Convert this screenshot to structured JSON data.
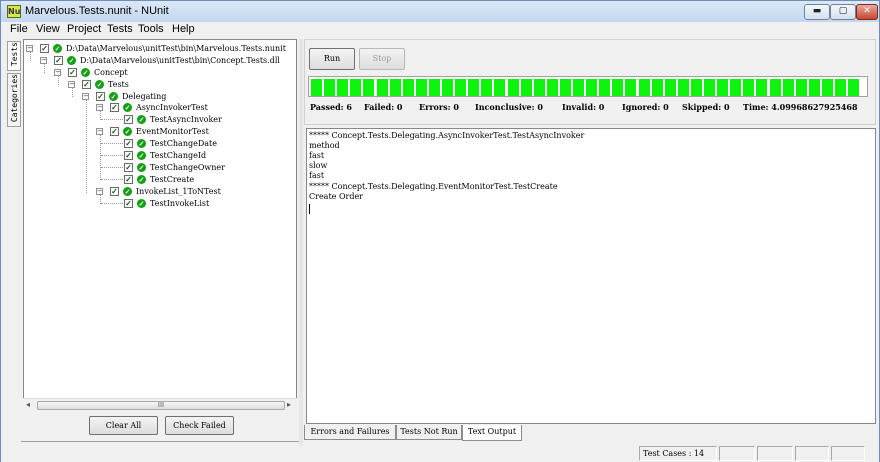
{
  "window": {
    "icon_text": "Nu",
    "title": "Marvelous.Tests.nunit - NUnit",
    "minimize_glyph": "▬",
    "maximize_glyph": "▢",
    "close_glyph": "✕"
  },
  "menu": [
    "File",
    "View",
    "Project",
    "Tests",
    "Tools",
    "Help"
  ],
  "side_tabs": [
    "Tests",
    "Categories"
  ],
  "tree": [
    {
      "label": "D:\\Data\\Marvelous\\unitTest\\bin\\Marvelous.Tests.nunit",
      "expanded": true
    },
    {
      "label": "D:\\Data\\Marvelous\\unitTest\\bin\\Concept.Tests.dll",
      "expanded": true
    },
    {
      "label": "Concept",
      "expanded": true
    },
    {
      "label": "Tests",
      "expanded": true
    },
    {
      "label": "Delegating",
      "expanded": true
    },
    {
      "label": "AsyncInvokerTest",
      "expanded": true
    },
    {
      "label": "TestAsyncInvoker"
    },
    {
      "label": "EventMonitorTest",
      "expanded": true
    },
    {
      "label": "TestChangeDate"
    },
    {
      "label": "TestChangeId"
    },
    {
      "label": "TestChangeOwner"
    },
    {
      "label": "TestCreate"
    },
    {
      "label": "InvokeList_1ToNTest",
      "expanded": true
    },
    {
      "label": "TestInvokeList"
    }
  ],
  "tree_icons": {
    "expanded_glyph": "−",
    "check_glyph": "✓",
    "pass_glyph": "✓"
  },
  "scrollbar": {
    "left_arrow": "◂",
    "right_arrow": "▸",
    "grip": "III"
  },
  "buttons": {
    "run": "Run",
    "stop": "Stop",
    "clear_all": "Clear All",
    "check_failed": "Check Failed"
  },
  "progress": {
    "fraction": 1.0,
    "color": "#0ef40e"
  },
  "summary": {
    "passed": "Passed: 6",
    "failed": "Failed: 0",
    "errors": "Errors: 0",
    "inconclusive": "Inconclusive: 0",
    "invalid": "Invalid: 0",
    "ignored": "Ignored: 0",
    "skipped": "Skipped: 0",
    "time": "Time: 4.09968627925468"
  },
  "output_lines": [
    "***** Concept.Tests.Delegating.AsyncInvokerTest.TestAsyncInvoker",
    "method",
    "fast",
    "slow",
    "fast",
    "***** Concept.Tests.Delegating.EventMonitorTest.TestCreate",
    "Create Order"
  ],
  "output_tabs": [
    "Errors and Failures",
    "Tests Not Run",
    "Text Output"
  ],
  "selected_output_tab": "Text Output",
  "status": {
    "test_cases": "Test Cases : 14"
  }
}
